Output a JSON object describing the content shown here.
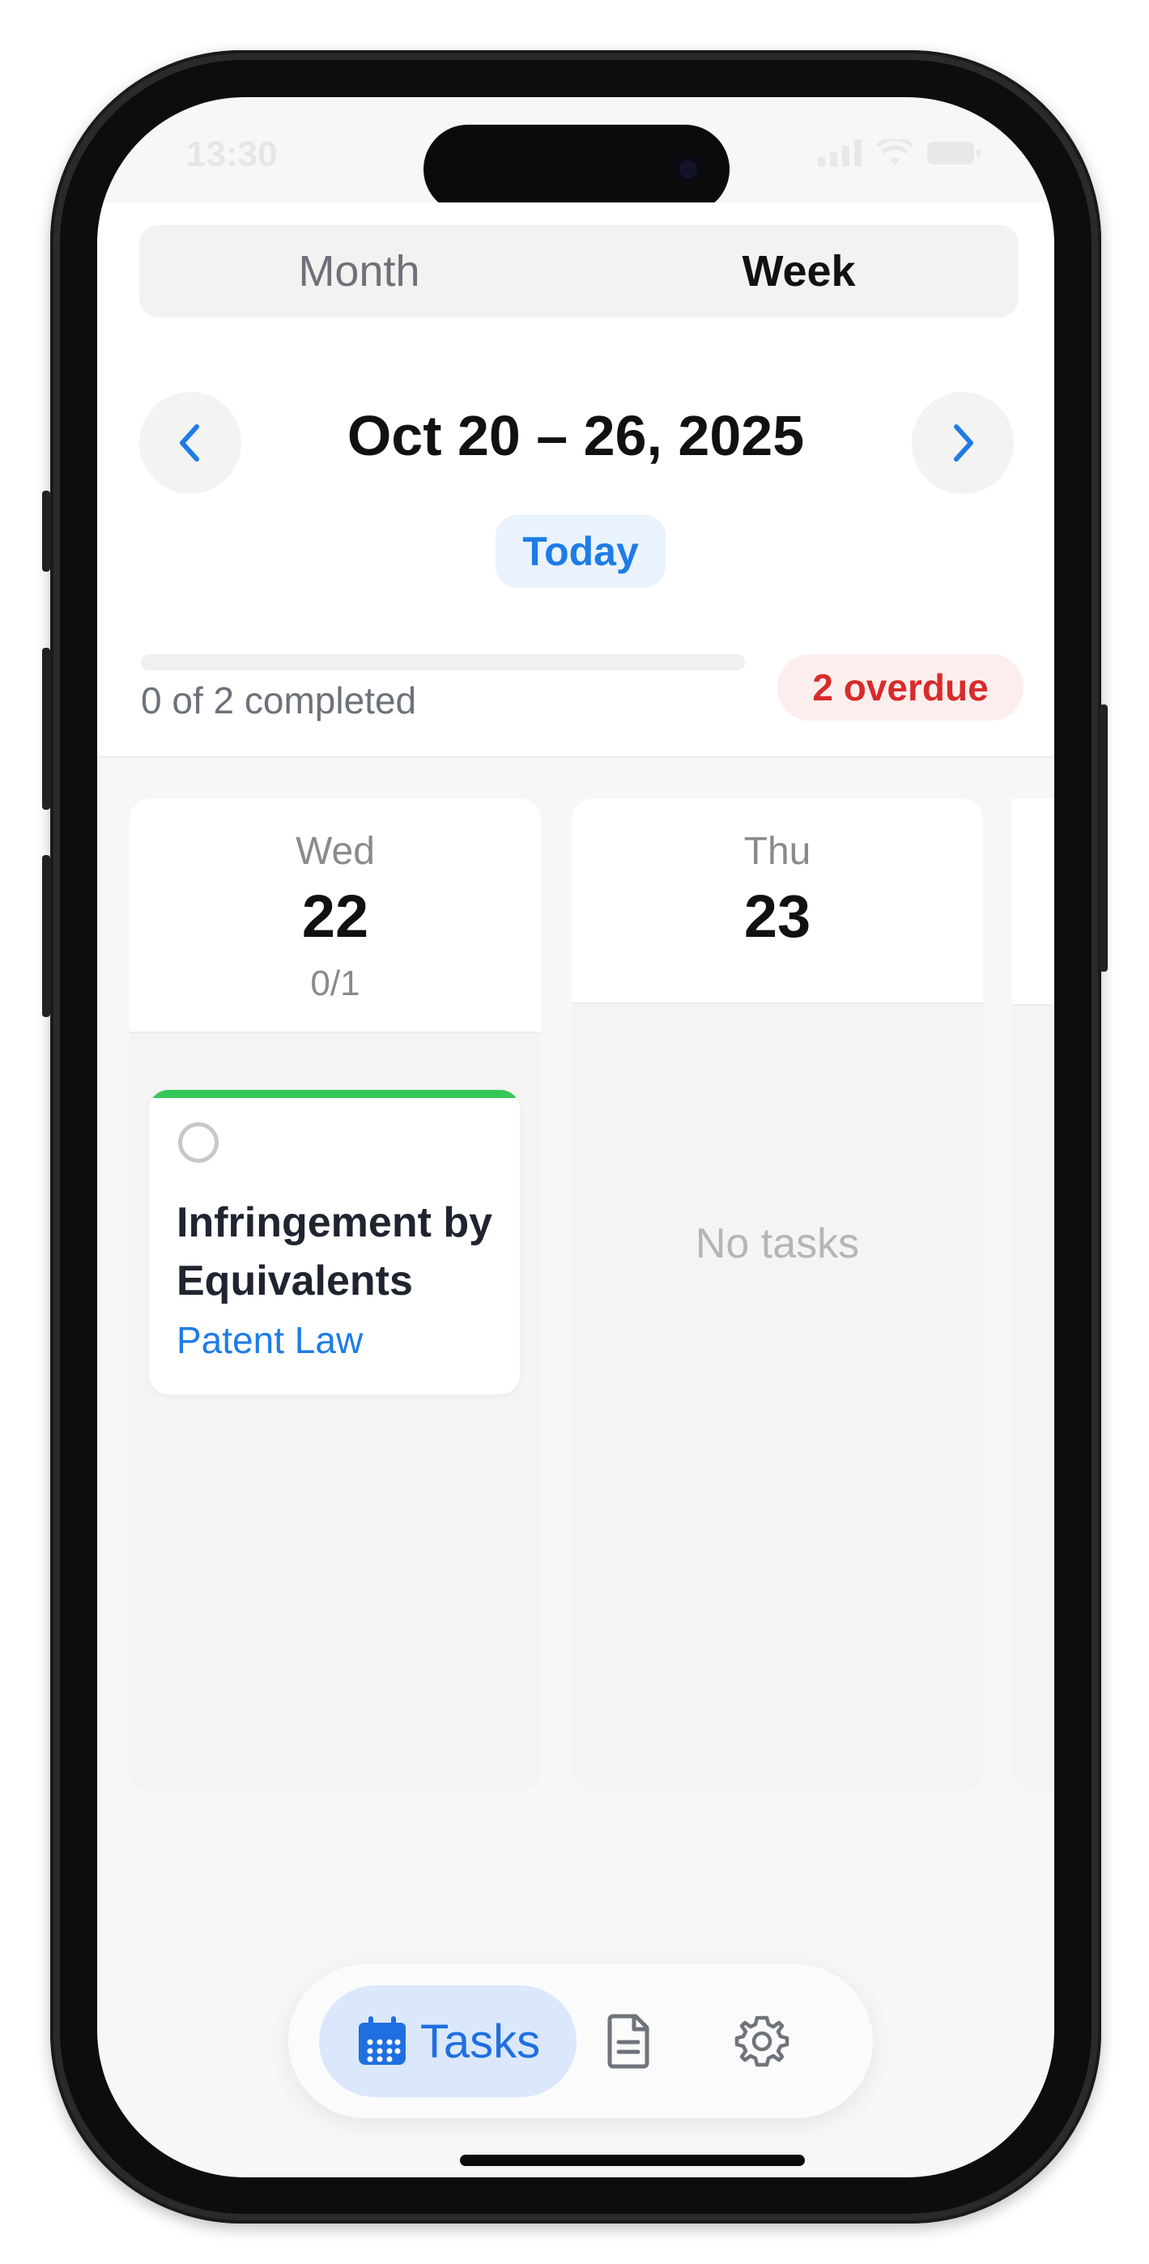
{
  "status_bar": {
    "time": "13:30"
  },
  "view_switch": {
    "month_label": "Month",
    "week_label": "Week",
    "active": "Week"
  },
  "week_nav": {
    "range_title": "Oct 20 – 26, 2025",
    "today_label": "Today"
  },
  "progress": {
    "text": "0 of 2 completed",
    "completed": 0,
    "total": 2,
    "overdue_label": "2 overdue"
  },
  "days": [
    {
      "name": "Wed",
      "number": "22",
      "count": "0/1",
      "tasks": [
        {
          "title": "Infringement by Equivalents",
          "tag": "Patent Law",
          "done": false,
          "accent": "#34c759"
        }
      ]
    },
    {
      "name": "Thu",
      "number": "23",
      "empty_text": "No tasks",
      "tasks": []
    }
  ],
  "tabbar": {
    "tasks_label": "Tasks",
    "icons": [
      "calendar-icon",
      "document-icon",
      "gear-icon"
    ]
  },
  "colors": {
    "accent": "#1e7ce6",
    "overdue": "#d82b2b",
    "success": "#34c759"
  }
}
